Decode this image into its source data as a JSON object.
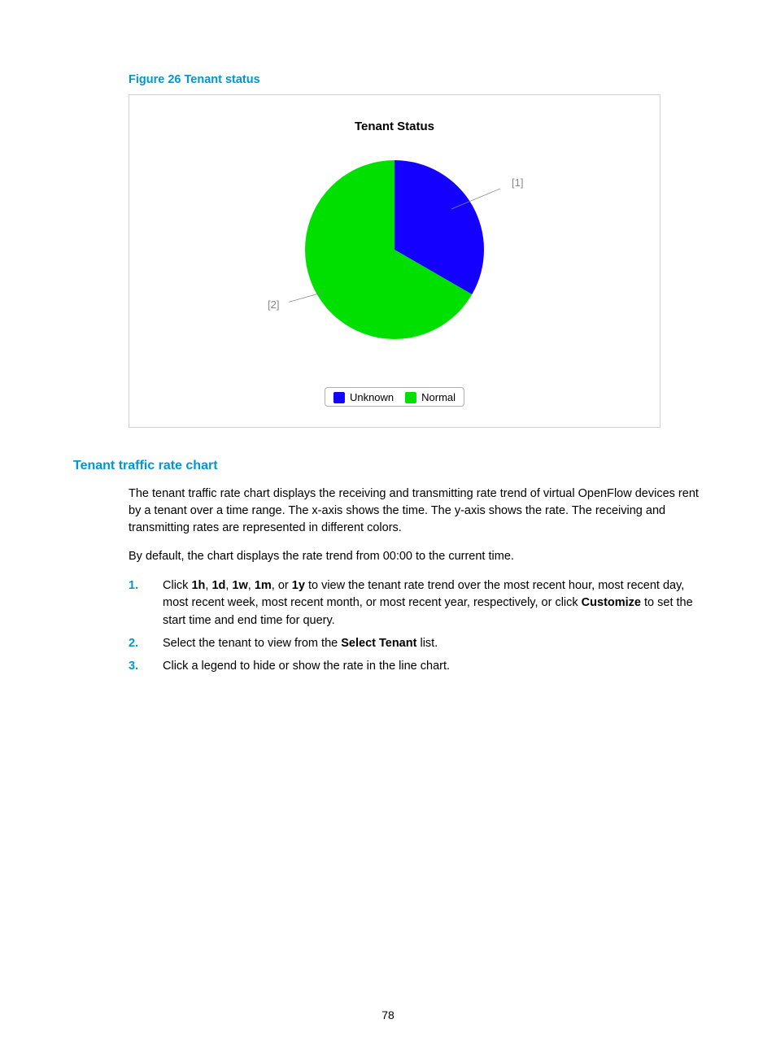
{
  "figure": {
    "caption": "Figure 26 Tenant status",
    "chart_title": "Tenant Status",
    "callout1": "[1]",
    "callout2": "[2]",
    "legend_unknown": "Unknown",
    "legend_normal": "Normal"
  },
  "section": {
    "heading": "Tenant traffic rate chart",
    "para1": "The tenant traffic rate chart displays the receiving and transmitting rate trend of virtual OpenFlow devices rent by a tenant over a time range. The x-axis shows the time. The y-axis shows the rate. The receiving and transmitting rates are represented in different colors.",
    "para2": "By default, the chart displays the rate trend from 00:00 to the current time.",
    "step1_a": "Click ",
    "step1_b1": "1h",
    "step1_c1": ", ",
    "step1_b2": "1d",
    "step1_c2": ", ",
    "step1_b3": "1w",
    "step1_c3": ", ",
    "step1_b4": "1m",
    "step1_c4": ", or ",
    "step1_b5": "1y",
    "step1_d": " to view the tenant rate trend over the most recent hour, most recent day, most recent week, most recent month, or most recent year, respectively, or click ",
    "step1_b6": "Customize",
    "step1_e": " to set the start time and end time for query.",
    "step2_a": "Select the tenant to view from the ",
    "step2_b": "Select Tenant",
    "step2_c": " list.",
    "step3": "Click a legend to hide or show the rate in the line chart."
  },
  "page_number": "78",
  "chart_data": {
    "type": "pie",
    "title": "Tenant Status",
    "series": [
      {
        "name": "Unknown",
        "value": 1,
        "color": "#1400ff"
      },
      {
        "name": "Normal",
        "value": 2,
        "color": "#00e000"
      }
    ],
    "callouts": [
      {
        "label": "[1]",
        "points_to": "Unknown"
      },
      {
        "label": "[2]",
        "points_to": "Normal"
      }
    ]
  }
}
